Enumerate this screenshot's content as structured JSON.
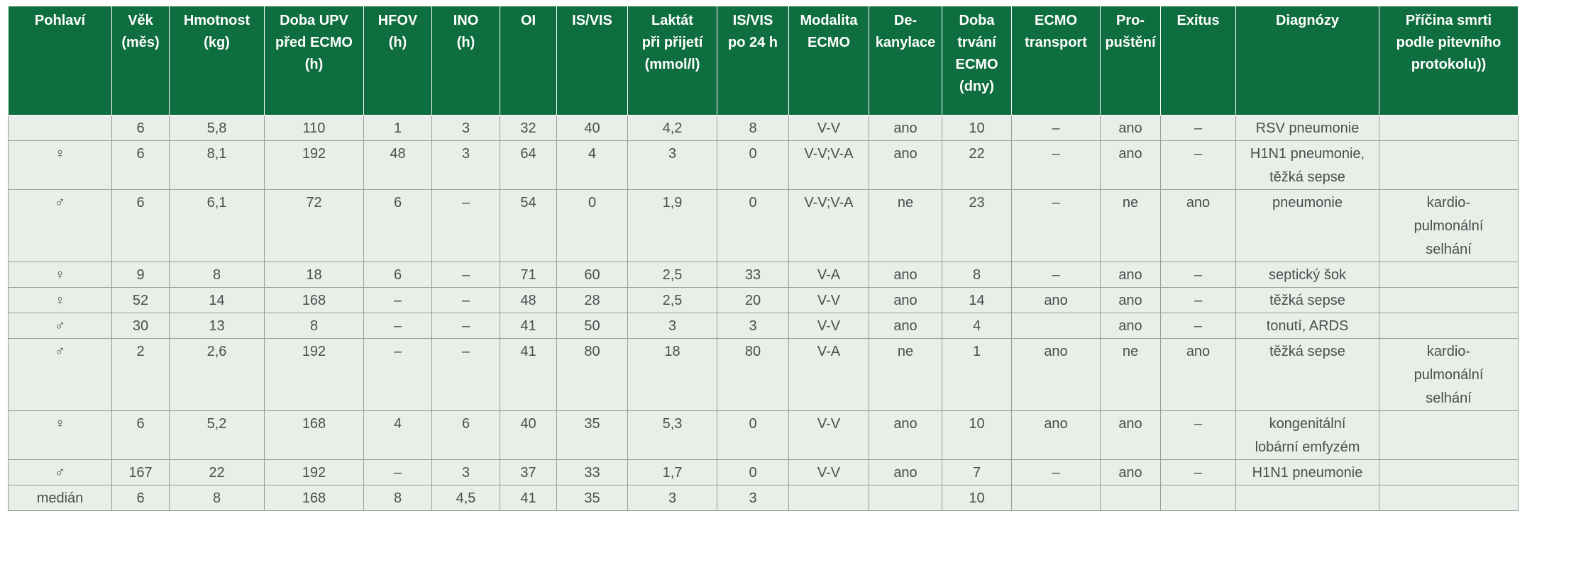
{
  "table": {
    "headers": [
      "Pohlaví",
      "Věk\n(měs)",
      "Hmotnost\n(kg)",
      "Doba UPV\npřed ECMO\n(h)",
      "HFOV\n(h)",
      "INO\n(h)",
      "OI",
      "IS/VIS",
      "Laktát\npři přijetí\n(mmol/l)",
      "IS/VIS\npo 24 h",
      "Modalita\nECMO",
      "De-\nkanylace",
      "Doba\ntrvání\nECMO\n(dny)",
      "ECMO\ntransport",
      "Pro-\npuštění",
      "Exitus",
      "Diagnózy",
      "Příčina smrti\npodle pitevního\nprotokolu))"
    ],
    "rows": [
      [
        "",
        "6",
        "5,8",
        "110",
        "1",
        "3",
        "32",
        "40",
        "4,2",
        "8",
        "V-V",
        "ano",
        "10",
        "–",
        "ano",
        "–",
        "RSV pneumonie",
        ""
      ],
      [
        "♀",
        "6",
        "8,1",
        "192",
        "48",
        "3",
        "64",
        "4",
        "3",
        "0",
        "V-V;V-A",
        "ano",
        "22",
        "–",
        "ano",
        "–",
        "H1N1 pneumonie,\ntěžká sepse",
        ""
      ],
      [
        "♂",
        "6",
        "6,1",
        "72",
        "6",
        "–",
        "54",
        "0",
        "1,9",
        "0",
        "V-V;V-A",
        "ne",
        "23",
        "–",
        "ne",
        "ano",
        "pneumonie",
        "kardio-\npulmonální\nselhání"
      ],
      [
        "♀",
        "9",
        "8",
        "18",
        "6",
        "–",
        "71",
        "60",
        "2,5",
        "33",
        "V-A",
        "ano",
        "8",
        "–",
        "ano",
        "–",
        "septický šok",
        ""
      ],
      [
        "♀",
        "52",
        "14",
        "168",
        "–",
        "–",
        "48",
        "28",
        "2,5",
        "20",
        "V-V",
        "ano",
        "14",
        "ano",
        "ano",
        "–",
        "těžká sepse",
        ""
      ],
      [
        "♂",
        "30",
        "13",
        "8",
        "–",
        "–",
        "41",
        "50",
        "3",
        "3",
        "V-V",
        "ano",
        "4",
        "",
        "ano",
        "–",
        "tonutí, ARDS",
        ""
      ],
      [
        "♂",
        "2",
        "2,6",
        "192",
        "–",
        "–",
        "41",
        "80",
        "18",
        "80",
        "V-A",
        "ne",
        "1",
        "ano",
        "ne",
        "ano",
        "těžká sepse",
        "kardio-\npulmonální\nselhání"
      ],
      [
        "♀",
        "6",
        "5,2",
        "168",
        "4",
        "6",
        "40",
        "35",
        "5,3",
        "0",
        "V-V",
        "ano",
        "10",
        "ano",
        "ano",
        "–",
        "kongenitální\nlobární emfyzém",
        ""
      ],
      [
        "♂",
        "167",
        "22",
        "192",
        "–",
        "3",
        "37",
        "33",
        "1,7",
        "0",
        "V-V",
        "ano",
        "7",
        "–",
        "ano",
        "–",
        "H1N1 pneumonie",
        ""
      ],
      [
        "medián",
        "6",
        "8",
        "168",
        "8",
        "4,5",
        "41",
        "35",
        "3",
        "3",
        "",
        "",
        "10",
        "",
        "",
        "",
        "",
        ""
      ]
    ]
  }
}
